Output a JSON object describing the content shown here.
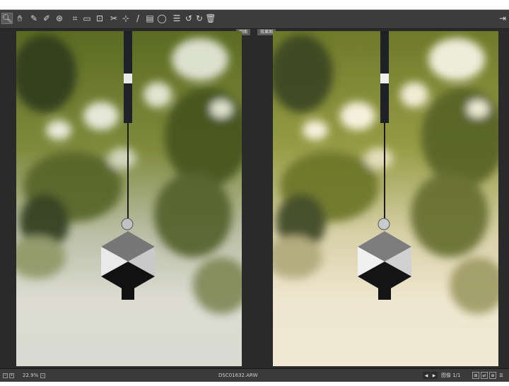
{
  "toolbar": {
    "tools": [
      {
        "icon": "zoom-icon",
        "glyph": "🔍︎"
      },
      {
        "icon": "hand-icon",
        "glyph": "✋︎"
      },
      {
        "icon": "eyedropper-icon",
        "glyph": "✎"
      },
      {
        "icon": "color-sampler-icon",
        "glyph": "✐"
      },
      {
        "icon": "target-adjust-icon",
        "glyph": "⊛"
      },
      {
        "icon": "crop-icon",
        "glyph": "⌗"
      },
      {
        "icon": "ruler-icon",
        "glyph": "▭"
      },
      {
        "icon": "transform-icon",
        "glyph": "⊡"
      },
      {
        "icon": "spot-removal-icon",
        "glyph": "✂"
      },
      {
        "icon": "redeye-icon",
        "glyph": "⊹"
      },
      {
        "icon": "brush-icon",
        "glyph": "/"
      },
      {
        "icon": "graduated-filter-icon",
        "glyph": "▤"
      },
      {
        "icon": "radial-filter-icon",
        "glyph": "◯"
      },
      {
        "icon": "list-icon",
        "glyph": "☰"
      },
      {
        "icon": "rotate-left-icon",
        "glyph": "↺"
      },
      {
        "icon": "rotate-right-icon",
        "glyph": "↻"
      },
      {
        "icon": "trash-icon",
        "glyph": "🗑︎"
      }
    ],
    "exit_icon": "⇥"
  },
  "viewer": {
    "tab_before": "原图",
    "tab_after": "效果图"
  },
  "status": {
    "zoom": "22.9%",
    "filename": "DSC01632.ARW",
    "image_counter": "图像 1/1"
  }
}
